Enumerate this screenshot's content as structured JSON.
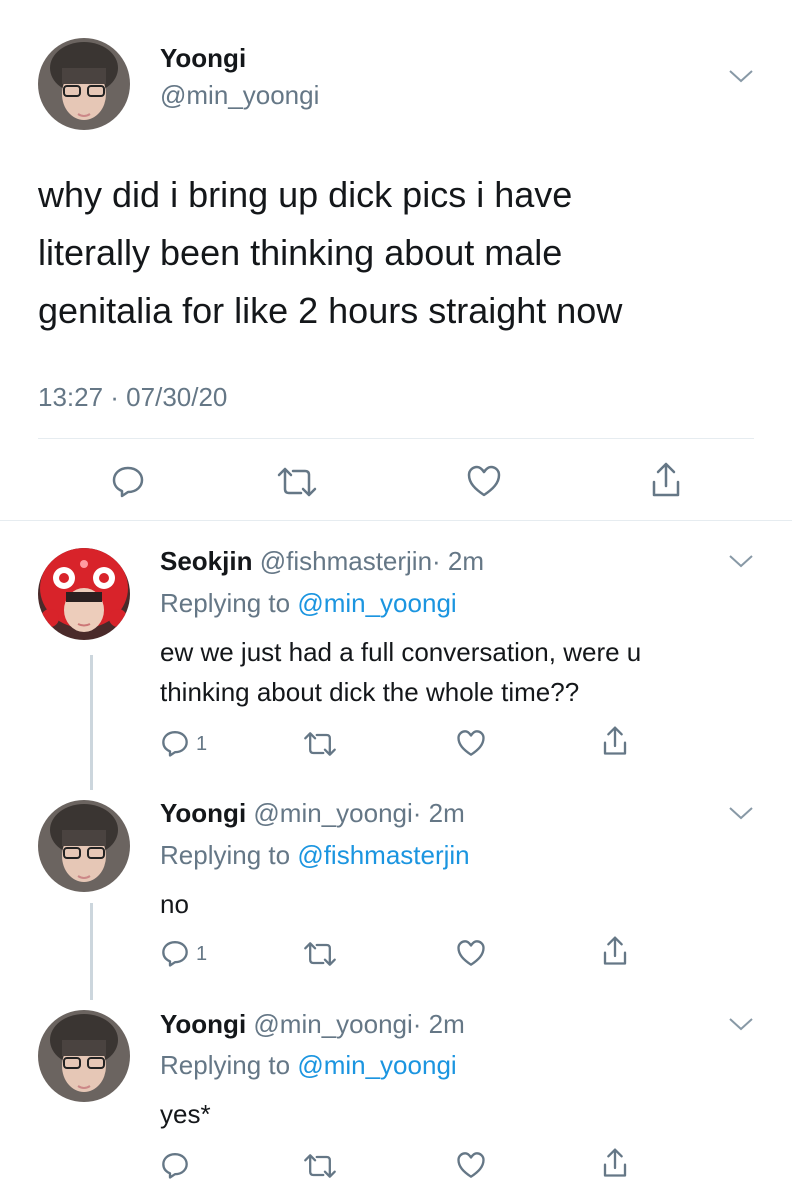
{
  "main_tweet": {
    "display_name": "Yoongi",
    "handle": "@min_yoongi",
    "text_lines": [
      "why did i bring up dick pics i have",
      "literally been thinking about male",
      "genitalia for like 2 hours straight now"
    ],
    "timestamp": "13:27 · 07/30/20"
  },
  "replies": [
    {
      "display_name": "Seokjin",
      "handle": "@fishmasterjin",
      "time": "· 2m",
      "replying_label": "Replying to",
      "replying_to": "@min_yoongi",
      "text_lines": [
        "ew we just had a full conversation, were u",
        "thinking about dick the whole time??"
      ],
      "reply_count": "1"
    },
    {
      "display_name": "Yoongi",
      "handle": "@min_yoongi",
      "time": "· 2m",
      "replying_label": "Replying to",
      "replying_to": "@fishmasterjin",
      "text_lines": [
        "no"
      ],
      "reply_count": "1"
    },
    {
      "display_name": "Yoongi",
      "handle": "@min_yoongi",
      "time": "· 2m",
      "replying_label": "Replying to",
      "replying_to": "@min_yoongi",
      "text_lines": [
        "yes*"
      ],
      "reply_count": ""
    }
  ],
  "icons": {
    "reply": "speech-bubble-icon",
    "retweet": "retweet-arrows-icon",
    "like": "heart-icon",
    "share": "share-upload-icon",
    "menu": "chevron-down-icon"
  },
  "colors": {
    "text": "#14171a",
    "secondary": "#657786",
    "link": "#1b95e0",
    "divider": "#e6ecf0",
    "thread_line": "#ccd6dd"
  }
}
